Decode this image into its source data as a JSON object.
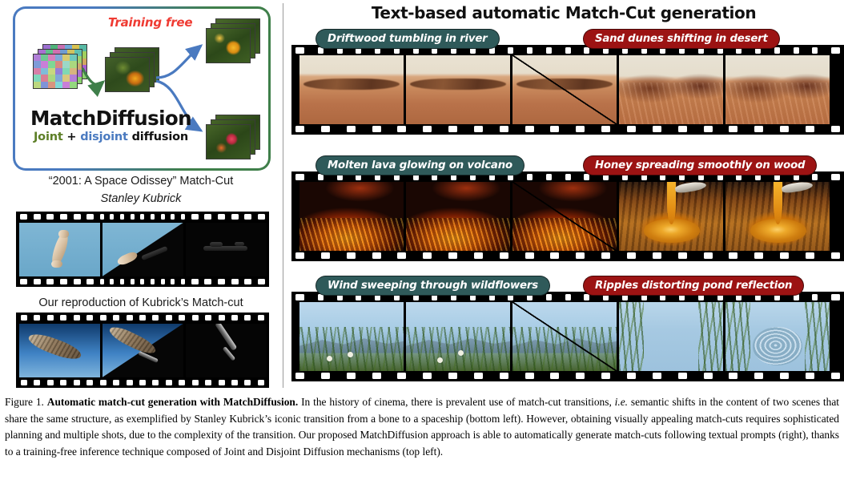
{
  "left_panel": {
    "training_free_label": "Training free",
    "brand": "MatchDiffusion",
    "sub": {
      "joint": "Joint",
      "plus": " + ",
      "disjoint": "disjoint",
      "diffusion": " diffusion"
    },
    "kubrick_title": "“2001: A Space Odissey” Match-Cut",
    "kubrick_author": "Stanley Kubrick",
    "reproduction_label": "Our reproduction of Kubrick’s Match-cut"
  },
  "right_panel": {
    "title": "Text-based automatic Match-Cut generation",
    "rows": [
      {
        "left_prompt": "Driftwood tumbling in river",
        "right_prompt": "Sand dunes shifting in desert"
      },
      {
        "left_prompt": "Molten lava glowing on volcano",
        "right_prompt": "Honey spreading smoothly on wood"
      },
      {
        "left_prompt": "Wind sweeping through wildflowers",
        "right_prompt": "Ripples distorting pond reflection"
      }
    ]
  },
  "caption": {
    "figure_number": "Figure 1.",
    "bold_lead": "Automatic match-cut generation with MatchDiffusion.",
    "text_1": " In the history of cinema, there is prevalent use of match-cut transitions, ",
    "italic_ie": "i.e.",
    "text_2": " semantic shifts in the content of two scenes that share the same structure, as exemplified by Stanley Kubrick’s iconic transition from a bone to a spaceship (bottom left). However, obtaining visually appealing match-cuts requires sophisticated planning and multiple shots, due to the complexity of the transition. Our proposed MatchDiffusion approach is able to automatically generate match-cuts following textual prompts (right), thanks to a training-free inference technique composed of Joint and Disjoint Diffusion mechanisms (top left)."
  },
  "colors": {
    "teal_pill": "#2f5a5a",
    "red_pill": "#9c1313",
    "training_free_red": "#ef3b33",
    "joint_green": "#5d7f27",
    "disjoint_blue": "#4a7ac0",
    "box_border_blue": "#4a7ac0",
    "box_border_green": "#3f7f4a"
  }
}
